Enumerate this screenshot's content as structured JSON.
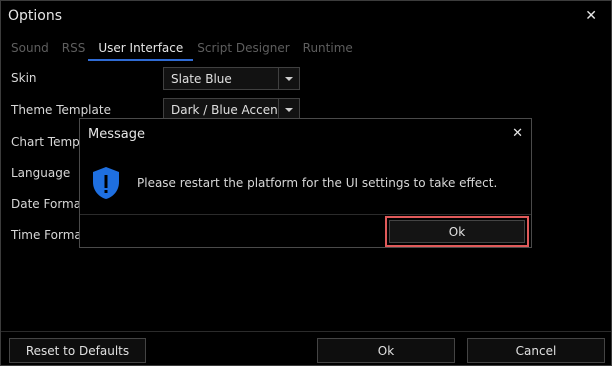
{
  "window": {
    "title": "Options",
    "close_glyph": "✕"
  },
  "tabs": [
    {
      "label": "Sound",
      "active": false
    },
    {
      "label": "RSS",
      "active": false
    },
    {
      "label": "User Interface",
      "active": true
    },
    {
      "label": "Script Designer",
      "active": false
    },
    {
      "label": "Runtime",
      "active": false
    }
  ],
  "settings": {
    "skin": {
      "label": "Skin",
      "value": "Slate Blue"
    },
    "theme_template": {
      "label": "Theme Template",
      "value": "Dark / Blue Accen"
    },
    "chart_template": {
      "label": "Chart Temp"
    },
    "language": {
      "label": "Language"
    },
    "date_format": {
      "label": "Date Forma"
    },
    "time_format": {
      "label": "Time Forma"
    }
  },
  "footer": {
    "reset_label": "Reset to Defaults",
    "ok_label": "Ok",
    "cancel_label": "Cancel"
  },
  "dialog": {
    "title": "Message",
    "close_glyph": "✕",
    "message": "Please restart the platform for the UI settings to take effect.",
    "ok_label": "Ok",
    "icon": "shield-alert-icon",
    "icon_color": "#1e6fe0",
    "highlight_color": "#e05a5a"
  }
}
